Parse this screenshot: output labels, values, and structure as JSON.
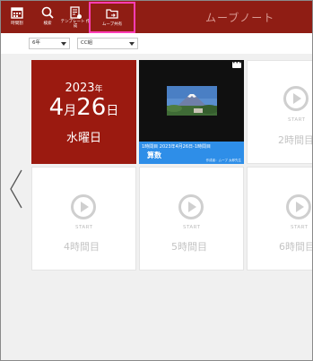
{
  "header": {
    "buttons": [
      {
        "label": "時間割",
        "icon": "calendar-icon"
      },
      {
        "label": "検索",
        "icon": "search-icon"
      },
      {
        "label": "テンプレート 作成",
        "icon": "template-icon"
      },
      {
        "label": "ムーブ共有",
        "icon": "share-folder-icon"
      }
    ],
    "title": "ムーブノート"
  },
  "filters": {
    "grade": "6年",
    "class": "CC組"
  },
  "date_tile": {
    "year": "2023",
    "year_unit": "年",
    "month": "4",
    "month_unit": "月",
    "day": "26",
    "day_unit": "日",
    "weekday": "水曜日"
  },
  "lesson": {
    "menu": "•••",
    "line1": "1時間目 2023年4月26日-1時間目",
    "subject": "算数",
    "author": "作成者：ムーブ 太郎先生"
  },
  "start_label": "START",
  "periods": [
    "2時間目",
    "4時間目",
    "5時間目",
    "6時間目"
  ],
  "colors": {
    "header": "#8f1d14",
    "date_tile": "#9b1a10",
    "lesson_bar": "#2e8ee8",
    "highlight": "#ff3db5"
  }
}
